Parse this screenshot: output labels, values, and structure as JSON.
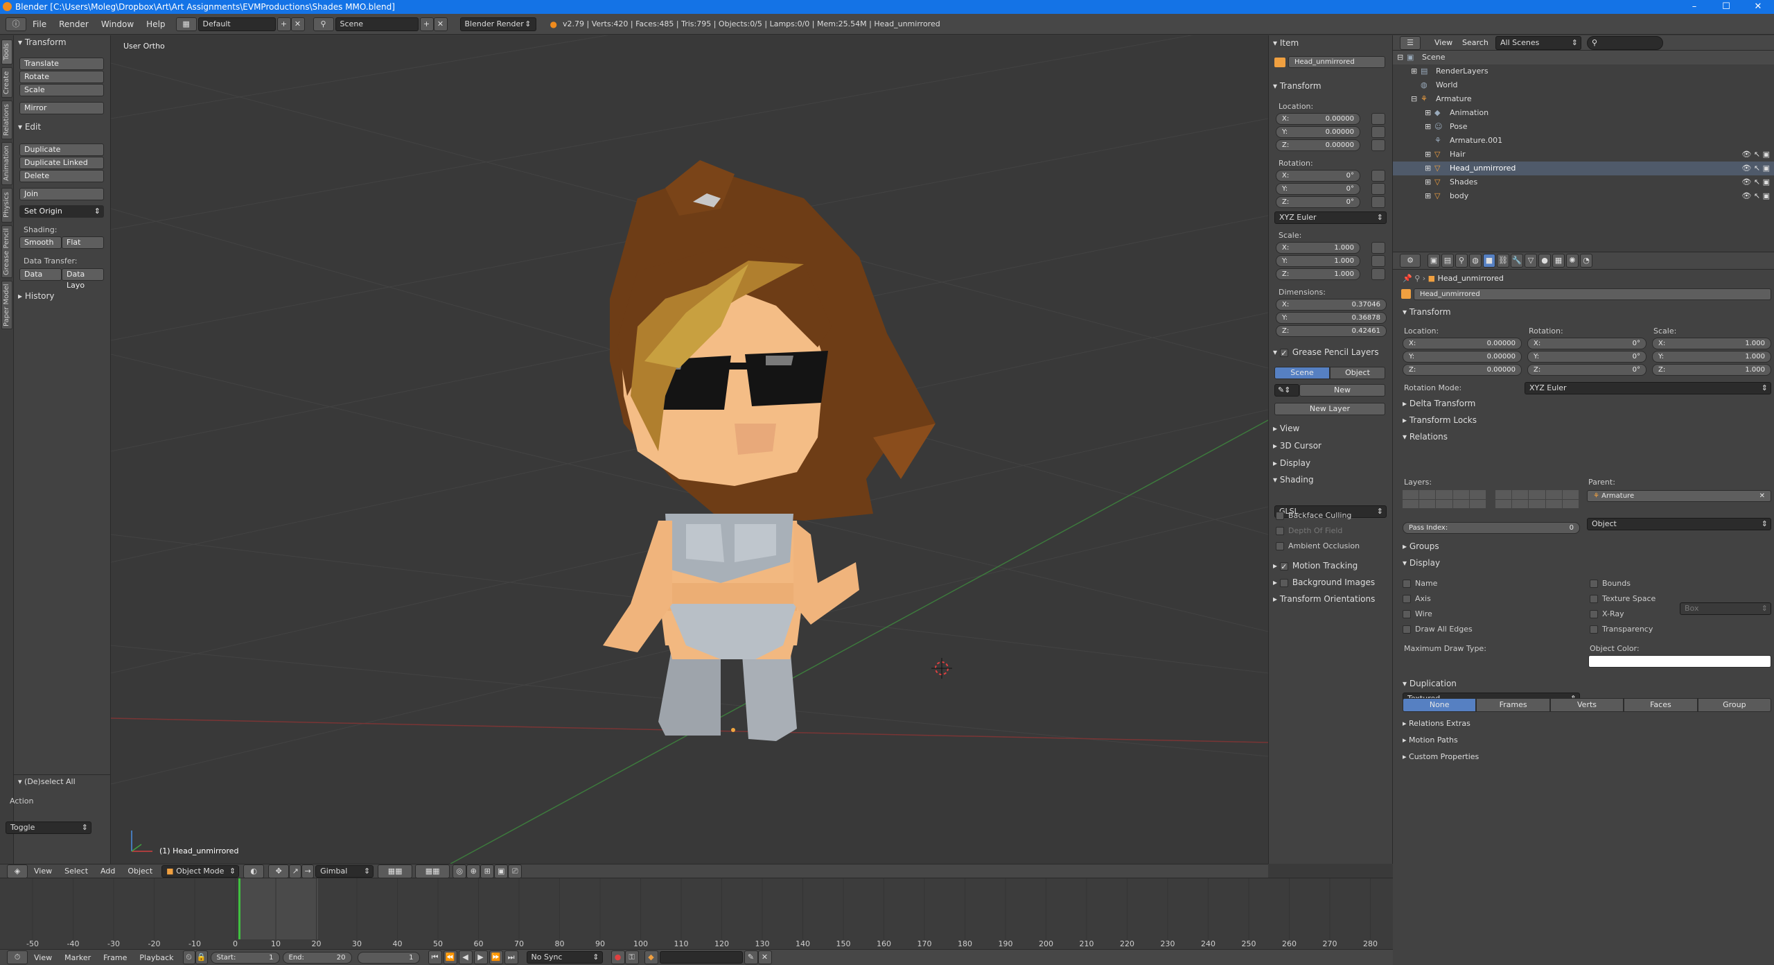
{
  "window": {
    "title": "Blender [C:\\Users\\Moleg\\Dropbox\\Art\\Art Assignments\\EVMProductions\\Shades MMO.blend]",
    "controls": [
      "–",
      "☐",
      "✕"
    ]
  },
  "topbar": {
    "menus": [
      "File",
      "Render",
      "Window",
      "Help"
    ],
    "layout": "Default",
    "scene": "Scene",
    "engine": "Blender Render",
    "stats": "v2.79 | Verts:420 | Faces:485 | Tris:795 | Objects:0/5 | Lamps:0/0 | Mem:25.54M | Head_unmirrored"
  },
  "tabs": [
    "Tools",
    "Create",
    "Relations",
    "Animation",
    "Physics",
    "Grease Pencil",
    "Paper Model"
  ],
  "toolshelf": {
    "transform_header": "Transform",
    "transform": [
      "Translate",
      "Rotate",
      "Scale"
    ],
    "mirror": "Mirror",
    "edit_header": "Edit",
    "edit": [
      "Duplicate",
      "Duplicate Linked",
      "Delete"
    ],
    "join": "Join",
    "set_origin": "Set Origin",
    "shading_label": "Shading:",
    "smooth": "Smooth",
    "flat": "Flat",
    "data_transfer_label": "Data Transfer:",
    "data": "Data",
    "data_layo": "Data Layo",
    "history": "History",
    "operator": "(De)select All",
    "action_label": "Action",
    "action_value": "Toggle"
  },
  "viewport": {
    "view_label": "User Ortho",
    "object_label": "(1) Head_unmirrored"
  },
  "vpheader": {
    "menus": [
      "View",
      "Select",
      "Add",
      "Object"
    ],
    "mode": "Object Mode",
    "orientation": "Gimbal"
  },
  "npanel": {
    "item_header": "Item",
    "object_name": "Head_unmirrored",
    "transform_header": "Transform",
    "location_label": "Location:",
    "location": [
      {
        "axis": "X:",
        "value": "0.00000"
      },
      {
        "axis": "Y:",
        "value": "0.00000"
      },
      {
        "axis": "Z:",
        "value": "0.00000"
      }
    ],
    "rotation_label": "Rotation:",
    "rotation": [
      {
        "axis": "X:",
        "value": "0°"
      },
      {
        "axis": "Y:",
        "value": "0°"
      },
      {
        "axis": "Z:",
        "value": "0°"
      }
    ],
    "rotation_mode": "XYZ Euler",
    "scale_label": "Scale:",
    "scale": [
      {
        "axis": "X:",
        "value": "1.000"
      },
      {
        "axis": "Y:",
        "value": "1.000"
      },
      {
        "axis": "Z:",
        "value": "1.000"
      }
    ],
    "dimensions_label": "Dimensions:",
    "dimensions": [
      {
        "axis": "X:",
        "value": "0.37046"
      },
      {
        "axis": "Y:",
        "value": "0.36878"
      },
      {
        "axis": "Z:",
        "value": "0.42461"
      }
    ],
    "gp_header": "Grease Pencil Layers",
    "gp_scene": "Scene",
    "gp_object": "Object",
    "gp_new": "New",
    "gp_new_layer": "New Layer",
    "view": "View",
    "cursor": "3D Cursor",
    "display": "Display",
    "shading": "Shading",
    "shading_mode": "GLSL",
    "backface": "Backface Culling",
    "dof": "Depth Of Field",
    "ao": "Ambient Occlusion",
    "motion": "Motion Tracking",
    "bg_images": "Background Images",
    "orientations": "Transform Orientations"
  },
  "outliner": {
    "view": "View",
    "search": "Search",
    "filter": "All Scenes",
    "rows": [
      {
        "label": "Scene"
      },
      {
        "label": "RenderLayers"
      },
      {
        "label": "World"
      },
      {
        "label": "Armature"
      },
      {
        "label": "Animation"
      },
      {
        "label": "Pose"
      },
      {
        "label": "Armature.001"
      },
      {
        "label": "Hair"
      },
      {
        "label": "Head_unmirrored"
      },
      {
        "label": "Shades"
      },
      {
        "label": "body"
      }
    ]
  },
  "properties": {
    "object_path": "Head_unmirrored",
    "name": "Head_unmirrored",
    "transform": "Transform",
    "location_label": "Location:",
    "rotation_label": "Rotation:",
    "scale_label": "Scale:",
    "location": [
      {
        "axis": "X:",
        "value": "0.00000"
      },
      {
        "axis": "Y:",
        "value": "0.00000"
      },
      {
        "axis": "Z:",
        "value": "0.00000"
      }
    ],
    "rotation": [
      {
        "axis": "X:",
        "value": "0°"
      },
      {
        "axis": "Y:",
        "value": "0°"
      },
      {
        "axis": "Z:",
        "value": "0°"
      }
    ],
    "scale": [
      {
        "axis": "X:",
        "value": "1.000"
      },
      {
        "axis": "Y:",
        "value": "1.000"
      },
      {
        "axis": "Z:",
        "value": "1.000"
      }
    ],
    "rotation_mode_label": "Rotation Mode:",
    "rotation_mode": "XYZ Euler",
    "delta": "Delta Transform",
    "locks": "Transform Locks",
    "relations": "Relations",
    "layers_label": "Layers:",
    "parent_label": "Parent:",
    "parent": "Armature",
    "parent_type": "Object",
    "pass_index_label": "Pass Index:",
    "pass_index": "0",
    "groups": "Groups",
    "display": "Display",
    "name_chk": "Name",
    "axis_chk": "Axis",
    "wire_chk": "Wire",
    "edges_chk": "Draw All Edges",
    "bounds_chk": "Bounds",
    "bounds_type": "Box",
    "texspace_chk": "Texture Space",
    "xray_chk": "X-Ray",
    "transp_chk": "Transparency",
    "max_draw_label": "Maximum Draw Type:",
    "max_draw": "Textured",
    "obj_color_label": "Object Color:",
    "duplication": "Duplication",
    "dup_options": [
      "None",
      "Frames",
      "Verts",
      "Faces",
      "Group"
    ],
    "relations_extras": "Relations Extras",
    "motion_paths": "Motion Paths",
    "custom_props": "Custom Properties"
  },
  "timeline": {
    "ticks": [
      "-50",
      "-40",
      "-30",
      "-20",
      "-10",
      "0",
      "10",
      "20",
      "30",
      "40",
      "50",
      "60",
      "70",
      "80",
      "90",
      "100",
      "110",
      "120",
      "130",
      "140",
      "150",
      "160",
      "170",
      "180",
      "190",
      "200",
      "210",
      "220",
      "230",
      "240",
      "250",
      "260",
      "270",
      "280"
    ],
    "current_frame": "1",
    "menus": [
      "View",
      "Marker",
      "Frame",
      "Playback"
    ],
    "start_label": "Start:",
    "start": "1",
    "end_label": "End:",
    "end": "20",
    "frame": "1",
    "sync": "No Sync"
  },
  "colors": {
    "accent": "#1473e6",
    "selected_button": "#5680c2",
    "viewport_bg": "#393939",
    "panel_bg": "#424242"
  }
}
